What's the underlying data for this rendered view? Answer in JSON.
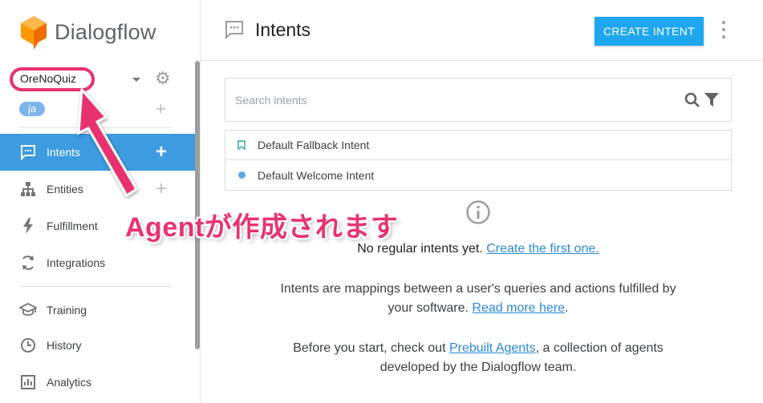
{
  "app": {
    "brand_name": "Dialogflow"
  },
  "agent": {
    "name": "OreNoQuiz",
    "language": "ja"
  },
  "sidebar": {
    "items": [
      {
        "label": "Intents",
        "icon": "chat-icon",
        "active": true,
        "has_add": true
      },
      {
        "label": "Entities",
        "icon": "entities-icon",
        "active": false,
        "has_add": true
      },
      {
        "label": "Fulfillment",
        "icon": "bolt-icon",
        "active": false,
        "has_add": false
      },
      {
        "label": "Integrations",
        "icon": "sync-icon",
        "active": false,
        "has_add": false
      },
      {
        "label": "Training",
        "icon": "graduation-cap-icon",
        "active": false,
        "has_add": false
      },
      {
        "label": "History",
        "icon": "clock-icon",
        "active": false,
        "has_add": false
      },
      {
        "label": "Analytics",
        "icon": "chart-icon",
        "active": false,
        "has_add": false
      }
    ]
  },
  "header": {
    "title": "Intents",
    "create_label": "CREATE INTENT"
  },
  "search": {
    "placeholder": "Search intents"
  },
  "intents": [
    {
      "name": "Default Fallback Intent",
      "marker": "bookmark-icon"
    },
    {
      "name": "Default Welcome Intent",
      "marker": "dot"
    }
  ],
  "info": {
    "empty_text": "No regular intents yet.",
    "empty_link": "Create the first one.",
    "desc_line1": "Intents are mappings between a user's queries and actions fulfilled by",
    "desc_line2_prefix": "your software.",
    "desc_link": "Read more here",
    "desc_line2_suffix": ".",
    "prebuilt_prefix": "Before you start, check out",
    "prebuilt_link": "Prebuilt Agents",
    "prebuilt_suffix": ", a collection of agents",
    "prebuilt_line2": "developed by the Dialogflow team."
  },
  "annotation": {
    "text": "Agentが作成されます"
  },
  "colors": {
    "accent": "#1ea7f0",
    "active_nav": "#3d9be0",
    "annotation": "#e8336f",
    "link": "#2b8ad6"
  }
}
